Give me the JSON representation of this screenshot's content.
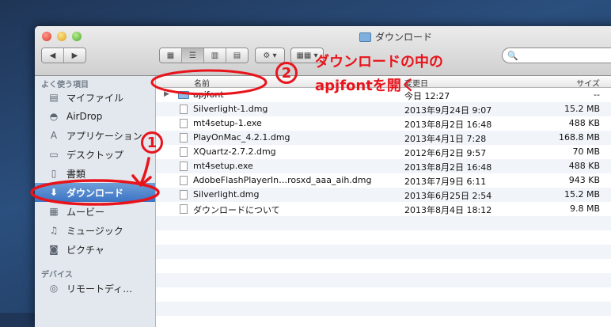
{
  "window": {
    "title": "ダウンロード"
  },
  "toolbar": {
    "back": "◀",
    "forward": "▶",
    "view_icons": "▦",
    "view_list": "☰",
    "view_columns": "▥",
    "view_coverflow": "▤",
    "action_gear": "⚙ ▾",
    "arrange": "▦▦ ▾",
    "search_icon": "🔍"
  },
  "sidebar": {
    "favorites_title": "よく使う項目",
    "devices_title": "デバイス",
    "items": [
      {
        "label": "マイファイル",
        "icon": "all-my-files-icon",
        "glyph": "▤"
      },
      {
        "label": "AirDrop",
        "icon": "airdrop-icon",
        "glyph": "◓"
      },
      {
        "label": "アプリケーション",
        "icon": "applications-icon",
        "glyph": "A"
      },
      {
        "label": "デスクトップ",
        "icon": "desktop-icon",
        "glyph": "▭"
      },
      {
        "label": "書類",
        "icon": "documents-icon",
        "glyph": "▯"
      },
      {
        "label": "ダウンロード",
        "icon": "downloads-icon",
        "glyph": "⬇"
      },
      {
        "label": "ムービー",
        "icon": "movies-icon",
        "glyph": "▦"
      },
      {
        "label": "ミュージック",
        "icon": "music-icon",
        "glyph": "♫"
      },
      {
        "label": "ピクチャ",
        "icon": "pictures-icon",
        "glyph": "◙"
      }
    ],
    "devices": [
      {
        "label": "リモートディ…",
        "icon": "remote-disc-icon",
        "glyph": "◎"
      }
    ]
  },
  "columns": {
    "name": "名前",
    "date": "変更日",
    "size": "サイズ"
  },
  "files": [
    {
      "name": "apjfont",
      "date": "今日 12:27",
      "size": "--",
      "kind": "folder"
    },
    {
      "name": "Silverlight-1.dmg",
      "date": "2013年9月24日 9:07",
      "size": "15.2 MB",
      "kind": "file"
    },
    {
      "name": "mt4setup-1.exe",
      "date": "2013年8月2日 16:48",
      "size": "488 KB",
      "kind": "file"
    },
    {
      "name": "PlayOnMac_4.2.1.dmg",
      "date": "2013年4月1日 7:28",
      "size": "168.8 MB",
      "kind": "file"
    },
    {
      "name": "XQuartz-2.7.2.dmg",
      "date": "2012年6月2日 9:57",
      "size": "70 MB",
      "kind": "file"
    },
    {
      "name": "mt4setup.exe",
      "date": "2013年8月2日 16:48",
      "size": "488 KB",
      "kind": "file"
    },
    {
      "name": "AdobeFlashPlayerIn…rosxd_aaa_aih.dmg",
      "date": "2013年7月9日 6:11",
      "size": "943 KB",
      "kind": "file"
    },
    {
      "name": "Silverlight.dmg",
      "date": "2013年6月25日 2:54",
      "size": "15.2 MB",
      "kind": "file"
    },
    {
      "name": "ダウンロードについて",
      "date": "2013年8月4日 18:12",
      "size": "9.8 MB",
      "kind": "file"
    }
  ],
  "annotations": {
    "step1_number": "1",
    "step2_number": "2",
    "step2_line1": "ダウンロードの中の",
    "step2_line2": "apjfontを開く",
    "color": "#e8141c"
  }
}
